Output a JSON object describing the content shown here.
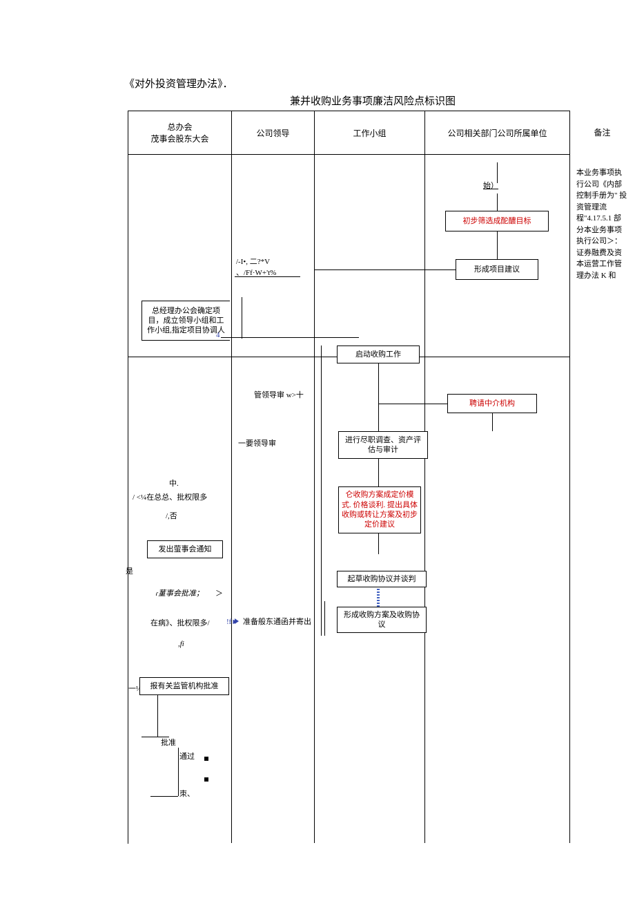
{
  "title1": "《对外投资管理办法》．",
  "title2": "兼并收购业务事项廉洁风险点标识图",
  "lanes": {
    "l1a": "总办会",
    "l1b": "茂事会股东大会",
    "l2": "公司领导",
    "l3": "工作小组",
    "l4": "公司相关部门公司所属单位"
  },
  "remark_label": "备注",
  "remark_body": "本业务事项执行公司《内部控制手册为\" 投资管理流程\"4.17.5.1 部分本业务事项执行公司＞：证券融费及资本运营工作管理办法 K 和",
  "nodes": {
    "start": "始）",
    "screen": "初步筛选成酡醲目标",
    "suggest": "形成项目建议",
    "garble1a": "/-I•, 二?*V",
    "garble1b": "、/Ff·W+'t%",
    "office": "总经理办公会确定项目，成立领导小组和工作小组,指定项目协调人",
    "office_mark": "4",
    "start_work": "启动收购工作",
    "leader_audit1": "管领导审 w>十",
    "hire": "聘请中介机构",
    "leader_audit2": "一要领导审",
    "dd": "进行尽职调查、资产评估与审计",
    "mid1": "中.",
    "mid2": "/ <¼在总总、批权限多",
    "mid3": "/,否",
    "pricing": "仑收购方案成定价模式. 价格谈利. 提出具体收购或转让方案及初步\n定价建议",
    "notice": "发出萤事会通知",
    "yes": "是",
    "board1": "ɾ蓳事会批准；",
    "board_gt": "＞",
    "draft": "起草收购协议并谈判",
    "plan": "形成收购方案及收购协议",
    "prepare": "准备般东通函并寄出",
    "prepare_mark": "!f►",
    "auth1": "在病》、批权限多/",
    "auth2": ",fi",
    "report_pre": "一¼",
    "report": "报有关监管机构批准",
    "approve": "批准",
    "pass": "通过",
    "end": "朿、"
  }
}
